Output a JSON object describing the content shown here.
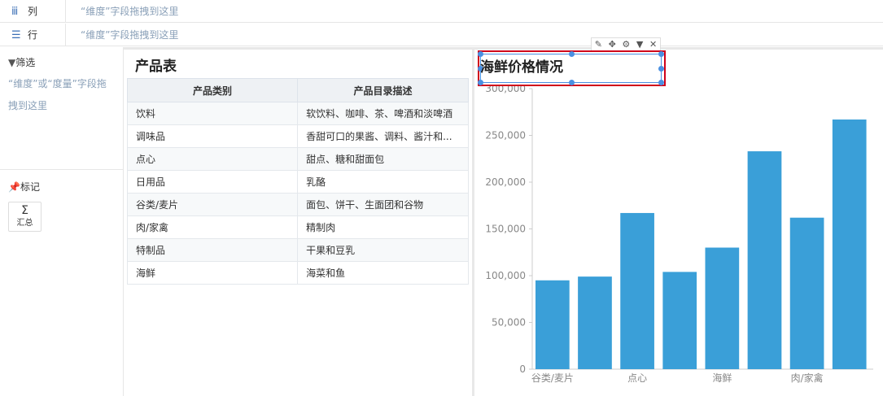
{
  "shelves": {
    "columns": {
      "icon": "columns-icon",
      "label": "列",
      "hint": "“维度”字段拖拽到这里"
    },
    "rows": {
      "icon": "rows-icon",
      "label": "行",
      "hint": "“维度”字段拖拽到这里"
    }
  },
  "left_panel": {
    "filter_title": "筛选",
    "filter_hint": "“维度”或“度量”字段拖拽到这里",
    "marks_title": "标记",
    "sum_label": "汇总"
  },
  "table": {
    "title": "产品表",
    "headers": [
      "产品类别",
      "产品目录描述"
    ],
    "rows": [
      [
        "饮料",
        "软饮料、咖啡、茶、啤酒和淡啤酒"
      ],
      [
        "调味品",
        "香甜可口的果酱、调料、酱汁和..."
      ],
      [
        "点心",
        "甜点、糖和甜面包"
      ],
      [
        "日用品",
        "乳酪"
      ],
      [
        "谷类/麦片",
        "面包、饼干、生面团和谷物"
      ],
      [
        "肉/家禽",
        "精制肉"
      ],
      [
        "特制品",
        "干果和豆乳"
      ],
      [
        "海鲜",
        "海菜和鱼"
      ]
    ]
  },
  "chart_toolbar": [
    "edit-icon",
    "move-icon",
    "settings-icon",
    "dropdown-icon",
    "close-icon"
  ],
  "chart_data": {
    "type": "bar",
    "title": "海鲜价格情况",
    "categories": [
      "谷类/麦片",
      "",
      "点心",
      "",
      "海鲜",
      "",
      "肉/家禽",
      ""
    ],
    "values": [
      95000,
      99000,
      167000,
      104000,
      130000,
      233000,
      162000,
      267000
    ],
    "ylim": [
      0,
      300000
    ],
    "yticks": [
      "0",
      "50,000",
      "100,000",
      "150,000",
      "200,000",
      "250,000",
      "300,000"
    ],
    "bar_color": "#3a9fd8",
    "grid": false
  }
}
